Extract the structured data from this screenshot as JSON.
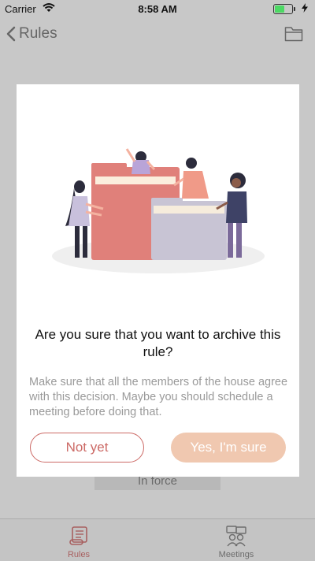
{
  "status_bar": {
    "carrier": "Carrier",
    "time": "8:58 AM",
    "battery_level": 0.55
  },
  "nav": {
    "back_label": "Rules"
  },
  "background": {
    "status_chip": "In force"
  },
  "modal": {
    "title": "Are you sure that you want to archive this rule?",
    "message": "Make sure that all the members of the house agree with this decision. Maybe you should schedule a meeting before doing that.",
    "cancel_label": "Not yet",
    "confirm_label": "Yes, I'm sure"
  },
  "tab_bar": {
    "tabs": [
      {
        "label": "Rules",
        "icon": "scroll-icon",
        "active": true
      },
      {
        "label": "Meetings",
        "icon": "meetings-icon",
        "active": false
      }
    ]
  },
  "colors": {
    "accent": "#cc6a66",
    "confirm_button": "#f0c8b0",
    "overlay": "#c8c8c8",
    "folder_red": "#e0807a",
    "folder_lavender": "#c8c4d4"
  }
}
